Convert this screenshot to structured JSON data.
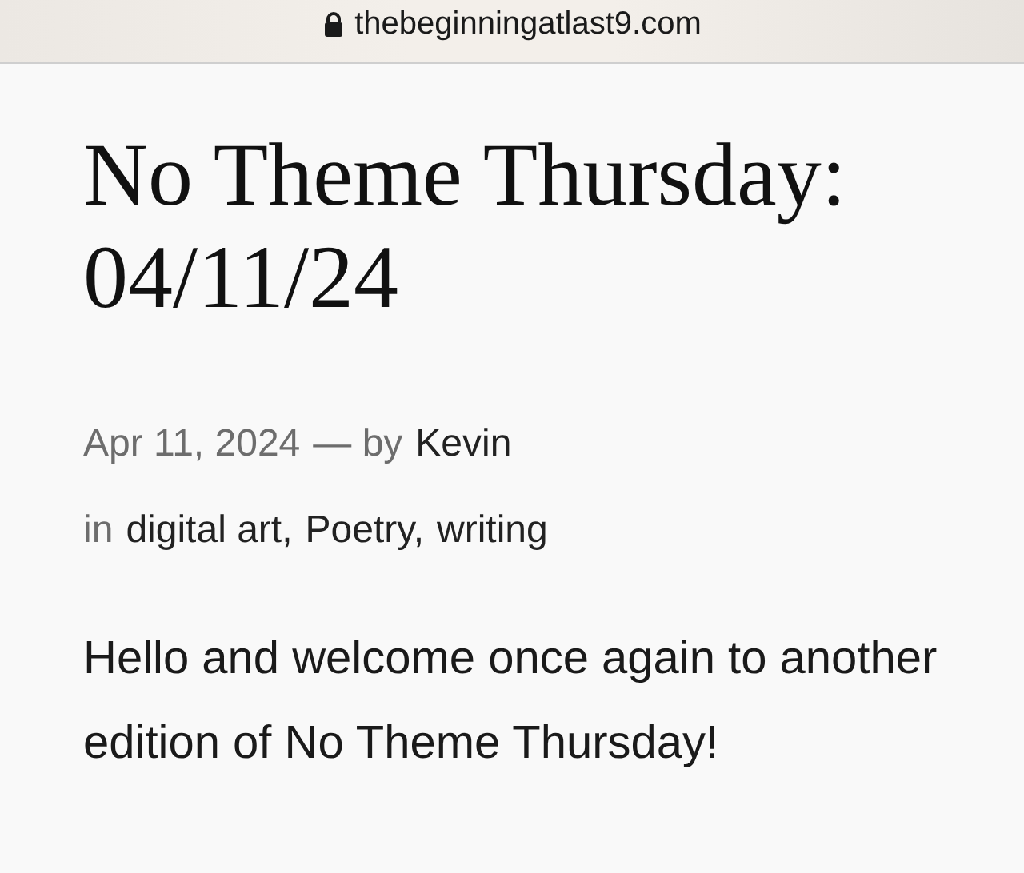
{
  "address_bar": {
    "url": "thebeginningatlast9.com",
    "secure": true
  },
  "post": {
    "title": "No Theme Thursday: 04/11/24",
    "date": "Apr 11, 2024",
    "byline": "— by",
    "author": "Kevin",
    "categories_label": "in",
    "categories": [
      "digital art,",
      "Poetry,",
      "writing"
    ],
    "body": "Hello and welcome once again to another edition of No Theme Thursday!"
  }
}
